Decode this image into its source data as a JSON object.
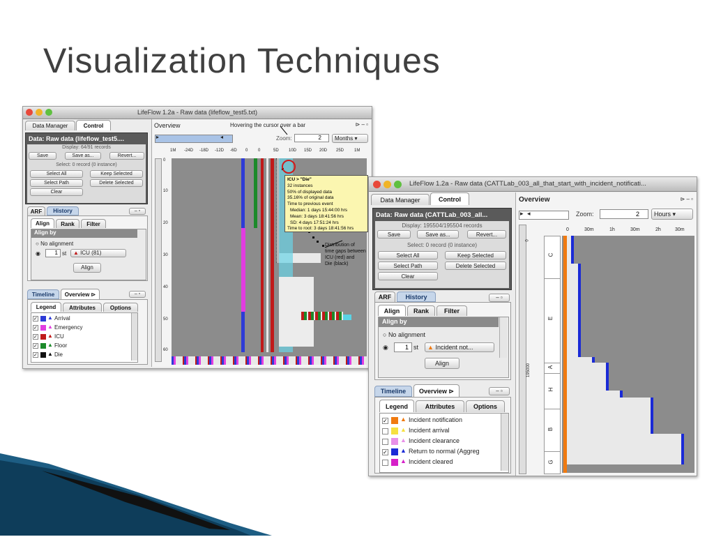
{
  "slide": {
    "title": "Visualization Techniques"
  },
  "win1": {
    "title": "LifeFlow 1.2a - Raw data (lifeflow_test5.txt)",
    "tabs": [
      "Data Manager",
      "Control"
    ],
    "data_label": "Data: Raw data (lifeflow_test5....",
    "display": "Display: 64/91 records",
    "buttons": {
      "save": "Save",
      "save_as": "Save as...",
      "revert": "Revert...",
      "select_all": "Select All",
      "keep_selected": "Keep Selected",
      "select_path": "Select Path",
      "delete_selected": "Delete Selected",
      "clear": "Clear"
    },
    "select_status": "Select: 0 record (0 instance)",
    "arf_tabs": [
      "ARF",
      "History"
    ],
    "sub_tabs": [
      "Align",
      "Rank",
      "Filter"
    ],
    "align_by": "Align by",
    "no_alignment": "No alignment",
    "align_num": "1",
    "align_suffix": "st",
    "align_event": "ICU (81)",
    "align_button": "Align",
    "lower_tabs": [
      "Timeline",
      "Overview"
    ],
    "legend_tabs": [
      "Legend",
      "Attributes",
      "Options"
    ],
    "legend": [
      {
        "label": "Arrival",
        "color": "#2d3bd6",
        "tri": "#2d3bd6"
      },
      {
        "label": "Emergency",
        "color": "#e23de0",
        "tri": "#e23de0"
      },
      {
        "label": "ICU",
        "color": "#c01a1a",
        "tri": "#c01a1a"
      },
      {
        "label": "Floor",
        "color": "#1c8a2a",
        "tri": "#1c8a2a"
      },
      {
        "label": "Die",
        "color": "#111111",
        "tri": "#111111"
      }
    ],
    "overview": "Overview",
    "annotation_top": "Hovering the cursor over a bar",
    "zoom_label": "Zoom:",
    "zoom_value": "2",
    "zoom_unit": "Months",
    "axis_ticks": [
      "1M",
      "-24D",
      "-18D",
      "-12D",
      "-6D",
      "0",
      "0",
      "5D",
      "10D",
      "15D",
      "20D",
      "25D",
      "1M"
    ],
    "tooltip": [
      "ICU > \"Die\"",
      "32 instances",
      "50% of displayed data",
      "35.16% of original data",
      "Time to previous event",
      "Median: 1 days 15:44:00 hrs",
      "Mean: 3 days 18:41:56 hrs",
      "SD: 4 days 17:51:24 hrs",
      "Time to root: 3 days 18:41:56 hrs"
    ],
    "annotation_dist": [
      "Distribution of",
      "time gaps between",
      "ICU (red) and",
      "Die (black)"
    ],
    "y_ticks": [
      "0",
      "10",
      "20",
      "30",
      "40",
      "50",
      "60"
    ]
  },
  "win2": {
    "title": "LifeFlow 1.2a - Raw data (CATTLab_003_all_that_start_with_incident_notificati...",
    "tabs": [
      "Data Manager",
      "Control"
    ],
    "data_label": "Data: Raw data (CATTLab_003_all...",
    "display": "Display: 195504/195504 records",
    "buttons": {
      "save": "Save",
      "save_as": "Save as...",
      "revert": "Revert...",
      "select_all": "Select All",
      "keep_selected": "Keep Selected",
      "select_path": "Select Path",
      "delete_selected": "Delete Selected",
      "clear": "Clear"
    },
    "select_status": "Select: 0 record (0 instance)",
    "arf_tabs": [
      "ARF",
      "History"
    ],
    "sub_tabs": [
      "Align",
      "Rank",
      "Filter"
    ],
    "align_by": "Align by",
    "no_alignment": "No alignment",
    "align_num": "1",
    "align_suffix": "st",
    "align_event": "Incident not...",
    "align_button": "Align",
    "lower_tabs": [
      "Timeline",
      "Overview"
    ],
    "legend_tabs": [
      "Legend",
      "Attributes",
      "Options"
    ],
    "legend": [
      {
        "label": "Incident notification",
        "checked": true,
        "color": "#f07a10",
        "tri": "#f07a10"
      },
      {
        "label": "Incident arrival",
        "checked": false,
        "color": "#f6e040",
        "tri": "#f6e040"
      },
      {
        "label": "Incident clearance",
        "checked": false,
        "color": "#e890e8",
        "tri": "#e890e8"
      },
      {
        "label": "Return to normal (Aggreg",
        "checked": true,
        "color": "#1a2ad6",
        "tri": "#1a2ad6"
      },
      {
        "label": "Incident cleared",
        "checked": false,
        "color": "#d620c8",
        "tri": "#d620c8"
      }
    ],
    "overview": "Overview",
    "zoom_label": "Zoom:",
    "zoom_value": "2",
    "zoom_unit": "Hours",
    "axis_ticks": [
      "0",
      "30m",
      "1h",
      "30m",
      "2h",
      "30m"
    ],
    "left_labels": [
      "C",
      "E",
      "A",
      "H",
      "B",
      "G"
    ],
    "left_number": "195000",
    "left_zero": "0"
  },
  "colors": {
    "plot_bg": "#888888",
    "blue": "#2d3bd6",
    "orange": "#f07a10"
  }
}
